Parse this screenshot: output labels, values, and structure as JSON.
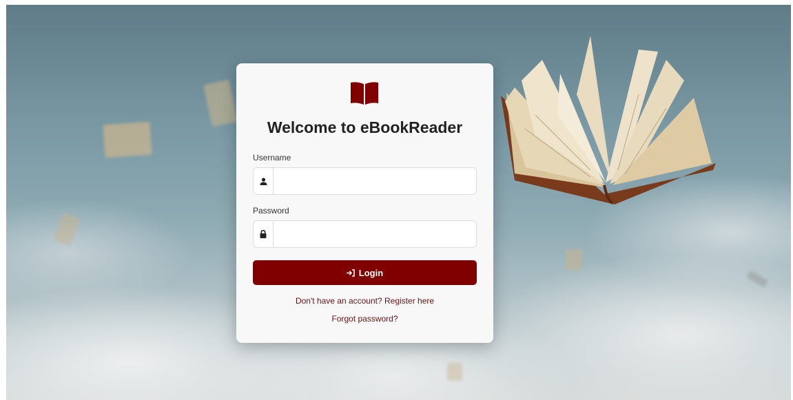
{
  "colors": {
    "brand": "#800000",
    "link": "#6b1010",
    "card_background": "#f8f8f8"
  },
  "icons": {
    "brand": "book-open-icon",
    "username": "user-icon",
    "password": "lock-icon",
    "login": "sign-in-icon"
  },
  "login_card": {
    "title": "Welcome to eBookReader",
    "username_label": "Username",
    "username_value": "",
    "password_label": "Password",
    "password_value": "",
    "login_button_label": "Login",
    "register_link": "Don't have an account? Register here",
    "forgot_password_link": "Forgot password?"
  }
}
